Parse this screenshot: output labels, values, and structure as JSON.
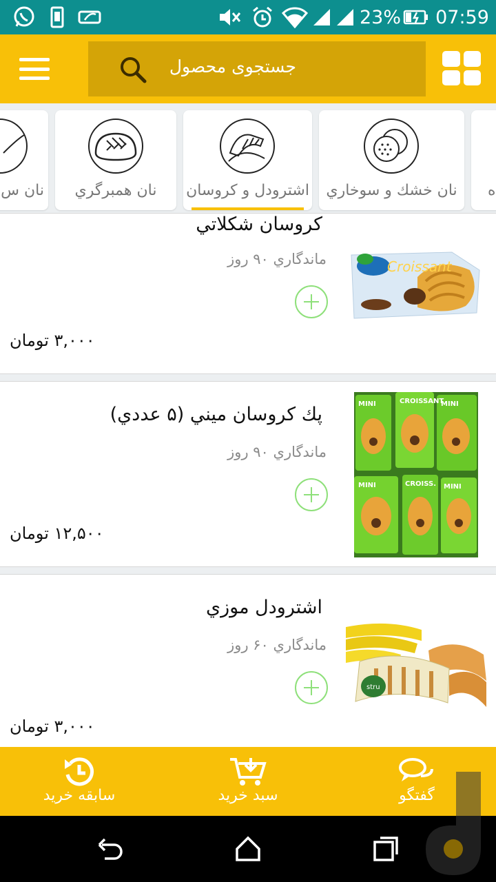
{
  "status_bar": {
    "battery": "23%",
    "time": "07:59",
    "icons": [
      "whatsapp-icon",
      "phone-vibrate-icon",
      "battery-saver-icon",
      "mute-icon",
      "alarm-icon",
      "wifi-icon",
      "signal-icon",
      "signal-2-icon",
      "battery-charging-icon"
    ]
  },
  "app_bar": {
    "search_placeholder": "جستجوی محصول",
    "icons": [
      "menu-icon",
      "search-icon",
      "grid-icon"
    ]
  },
  "categories": [
    {
      "label": "ه",
      "icon": "partial-category-icon",
      "selected": false
    },
    {
      "label": "نان خشك و سوخاري",
      "icon": "cracker-icon",
      "selected": false
    },
    {
      "label": "اشترودل و كروسان",
      "icon": "croissant-icon",
      "selected": true
    },
    {
      "label": "نان همبرگري",
      "icon": "burger-bun-icon",
      "selected": false
    },
    {
      "label": "نان س",
      "icon": "baguette-icon",
      "selected": false
    }
  ],
  "products": [
    {
      "title": "كروسان شكلاتي",
      "shelf_life": "ماندگاري ۹۰ روز",
      "price": "۳,۰۰۰ تومان",
      "image": "chocolate-croissant-image"
    },
    {
      "title": "پك كروسان ميني (۵ عددي)",
      "shelf_life": "ماندگاري ۹۰ روز",
      "price": "۱۲,۵۰۰ تومان",
      "image": "mini-croissant-pack-image"
    },
    {
      "title": "اشترودل موزي",
      "shelf_life": "ماندگاري ۶۰ روز",
      "price": "۳,۰۰۰ تومان",
      "image": "banana-strudel-image"
    }
  ],
  "bottom_nav": {
    "history_label": "سابقه خريد",
    "cart_label": "سبد خريد",
    "chat_label": "گفتگو"
  },
  "colors": {
    "status_bar": "#0d8f8f",
    "accent": "#f8c008",
    "search_box": "#d4a407",
    "add_button": "#8ee07a"
  }
}
